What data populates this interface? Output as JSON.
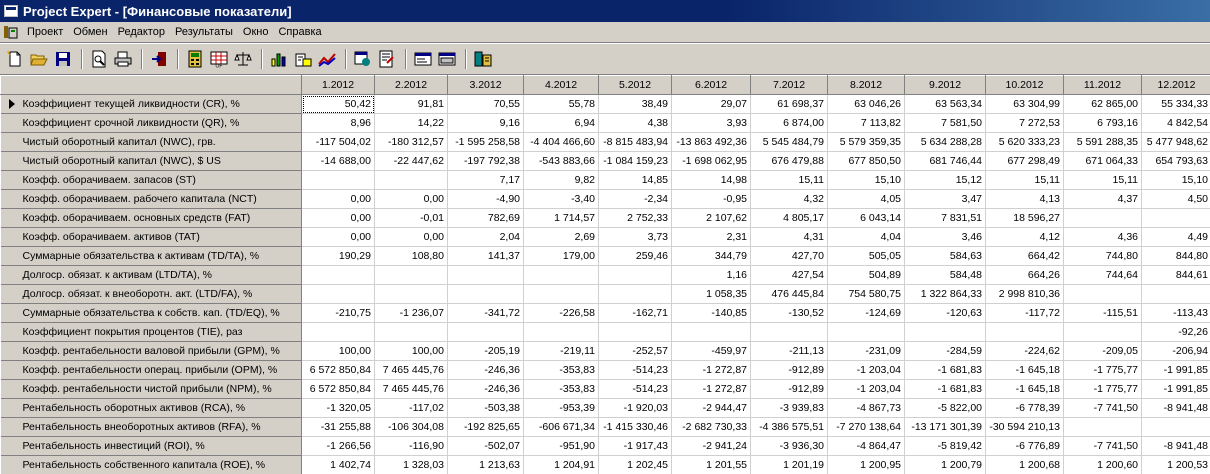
{
  "window": {
    "title": "Project Expert - [Финансовые показатели]"
  },
  "menu": {
    "items": [
      "Проект",
      "Обмен",
      "Редактор",
      "Результаты",
      "Окно",
      "Справка"
    ]
  },
  "toolbar": {
    "icons": [
      "new-document-icon",
      "open-folder-icon",
      "save-icon",
      "print-preview-icon",
      "print-icon",
      "exit-icon",
      "calculator-icon",
      "calendar-table-icon",
      "scales-icon",
      "chart-icon",
      "chart-add-icon",
      "line-graph-icon",
      "refresh-project-icon",
      "report-icon",
      "window-icon",
      "form-icon",
      "database-icon"
    ]
  },
  "grid": {
    "columns": [
      "1.2012",
      "2.2012",
      "3.2012",
      "4.2012",
      "5.2012",
      "6.2012",
      "7.2012",
      "8.2012",
      "9.2012",
      "10.2012",
      "11.2012",
      "12.2012"
    ],
    "rows": [
      {
        "label": "Коэффициент текущей ликвидности (CR), %",
        "values": [
          "50,42",
          "91,81",
          "70,55",
          "55,78",
          "38,49",
          "29,07",
          "61 698,37",
          "63 046,26",
          "63 563,34",
          "63 304,99",
          "62 865,00",
          "55 334,33"
        ]
      },
      {
        "label": "Коэффициент срочной ликвидности (QR), %",
        "values": [
          "8,96",
          "14,22",
          "9,16",
          "6,94",
          "4,38",
          "3,93",
          "6 874,00",
          "7 113,82",
          "7 581,50",
          "7 272,53",
          "6 793,16",
          "4 842,54"
        ]
      },
      {
        "label": "Чистый оборотный капитал (NWC), грв.",
        "values": [
          "-117 504,02",
          "-180 312,57",
          "-1 595 258,58",
          "-4 404 466,60",
          "-8 815 483,94",
          "-13 863 492,36",
          "5 545 484,79",
          "5 579 359,35",
          "5 634 288,28",
          "5 620 333,23",
          "5 591 288,35",
          "5 477 948,62"
        ]
      },
      {
        "label": "Чистый оборотный капитал (NWC), $ US",
        "values": [
          "-14 688,00",
          "-22 447,62",
          "-197 792,38",
          "-543 883,66",
          "-1 084 159,23",
          "-1 698 062,95",
          "676 479,88",
          "677 850,50",
          "681 746,44",
          "677 298,49",
          "671 064,33",
          "654 793,63"
        ]
      },
      {
        "label": "Коэфф. оборачиваем. запасов (ST)",
        "values": [
          "",
          "",
          "7,17",
          "9,82",
          "14,85",
          "14,98",
          "15,11",
          "15,10",
          "15,12",
          "15,11",
          "15,11",
          "15,10"
        ]
      },
      {
        "label": "Коэфф. оборачиваем. рабочего капитала (NCT)",
        "values": [
          "0,00",
          "0,00",
          "-4,90",
          "-3,40",
          "-2,34",
          "-0,95",
          "4,32",
          "4,05",
          "3,47",
          "4,13",
          "4,37",
          "4,50"
        ]
      },
      {
        "label": "Коэфф. оборачиваем. основных средств (FAT)",
        "values": [
          "0,00",
          "-0,01",
          "782,69",
          "1 714,57",
          "2 752,33",
          "2 107,62",
          "4 805,17",
          "6 043,14",
          "7 831,51",
          "18 596,27",
          "",
          ""
        ]
      },
      {
        "label": "Коэфф. оборачиваем. активов (TAT)",
        "values": [
          "0,00",
          "0,00",
          "2,04",
          "2,69",
          "3,73",
          "2,31",
          "4,31",
          "4,04",
          "3,46",
          "4,12",
          "4,36",
          "4,49"
        ]
      },
      {
        "label": "Суммарные обязательства к активам (TD/TA), %",
        "values": [
          "190,29",
          "108,80",
          "141,37",
          "179,00",
          "259,46",
          "344,79",
          "427,70",
          "505,05",
          "584,63",
          "664,42",
          "744,80",
          "844,80"
        ]
      },
      {
        "label": "Долгоср. обязат. к активам (LTD/TA), %",
        "values": [
          "",
          "",
          "",
          "",
          "",
          "1,16",
          "427,54",
          "504,89",
          "584,48",
          "664,26",
          "744,64",
          "844,61"
        ]
      },
      {
        "label": "Долгоср. обязат. к внеоборотн. акт. (LTD/FA), %",
        "values": [
          "",
          "",
          "",
          "",
          "",
          "1 058,35",
          "476 445,84",
          "754 580,75",
          "1 322 864,33",
          "2 998 810,36",
          "",
          ""
        ]
      },
      {
        "label": "Суммарные обязательства к собств. кап. (TD/EQ), %",
        "values": [
          "-210,75",
          "-1 236,07",
          "-341,72",
          "-226,58",
          "-162,71",
          "-140,85",
          "-130,52",
          "-124,69",
          "-120,63",
          "-117,72",
          "-115,51",
          "-113,43"
        ]
      },
      {
        "label": "Коэффициент покрытия процентов (TIE), раз",
        "values": [
          "",
          "",
          "",
          "",
          "",
          "",
          "",
          "",
          "",
          "",
          "",
          "-92,26"
        ]
      },
      {
        "label": "Коэфф. рентабельности валовой прибыли (GPM), %",
        "values": [
          "100,00",
          "100,00",
          "-205,19",
          "-219,11",
          "-252,57",
          "-459,97",
          "-211,13",
          "-231,09",
          "-284,59",
          "-224,62",
          "-209,05",
          "-206,94"
        ]
      },
      {
        "label": "Коэфф. рентабельности операц. прибыли (OPM), %",
        "values": [
          "6 572 850,84",
          "7 465 445,76",
          "-246,36",
          "-353,83",
          "-514,23",
          "-1 272,87",
          "-912,89",
          "-1 203,04",
          "-1 681,83",
          "-1 645,18",
          "-1 775,77",
          "-1 991,85"
        ]
      },
      {
        "label": "Коэфф. рентабельности чистой прибыли (NPM), %",
        "values": [
          "6 572 850,84",
          "7 465 445,76",
          "-246,36",
          "-353,83",
          "-514,23",
          "-1 272,87",
          "-912,89",
          "-1 203,04",
          "-1 681,83",
          "-1 645,18",
          "-1 775,77",
          "-1 991,85"
        ]
      },
      {
        "label": "Рентабельность оборотных активов (RCA), %",
        "values": [
          "-1 320,05",
          "-117,02",
          "-503,38",
          "-953,39",
          "-1 920,03",
          "-2 944,47",
          "-3 939,83",
          "-4 867,73",
          "-5 822,00",
          "-6 778,39",
          "-7 741,50",
          "-8 941,48"
        ]
      },
      {
        "label": "Рентабельность внеоборотных активов (RFA), %",
        "values": [
          "-31 255,88",
          "-106 304,08",
          "-192 825,65",
          "-606 671,34",
          "-1 415 330,46",
          "-2 682 730,33",
          "-4 386 575,51",
          "-7 270 138,64",
          "-13 171 301,39",
          "-30 594 210,13",
          "",
          ""
        ]
      },
      {
        "label": "Рентабельность инвестиций (ROI), %",
        "values": [
          "-1 266,56",
          "-116,90",
          "-502,07",
          "-951,90",
          "-1 917,43",
          "-2 941,24",
          "-3 936,30",
          "-4 864,47",
          "-5 819,42",
          "-6 776,89",
          "-7 741,50",
          "-8 941,48"
        ]
      },
      {
        "label": "Рентабельность собственного капитала (ROE), %",
        "values": [
          "1 402,74",
          "1 328,03",
          "1 213,63",
          "1 204,91",
          "1 202,45",
          "1 201,55",
          "1 201,19",
          "1 200,95",
          "1 200,79",
          "1 200,68",
          "1 200,60",
          "1 200,53"
        ]
      }
    ]
  }
}
